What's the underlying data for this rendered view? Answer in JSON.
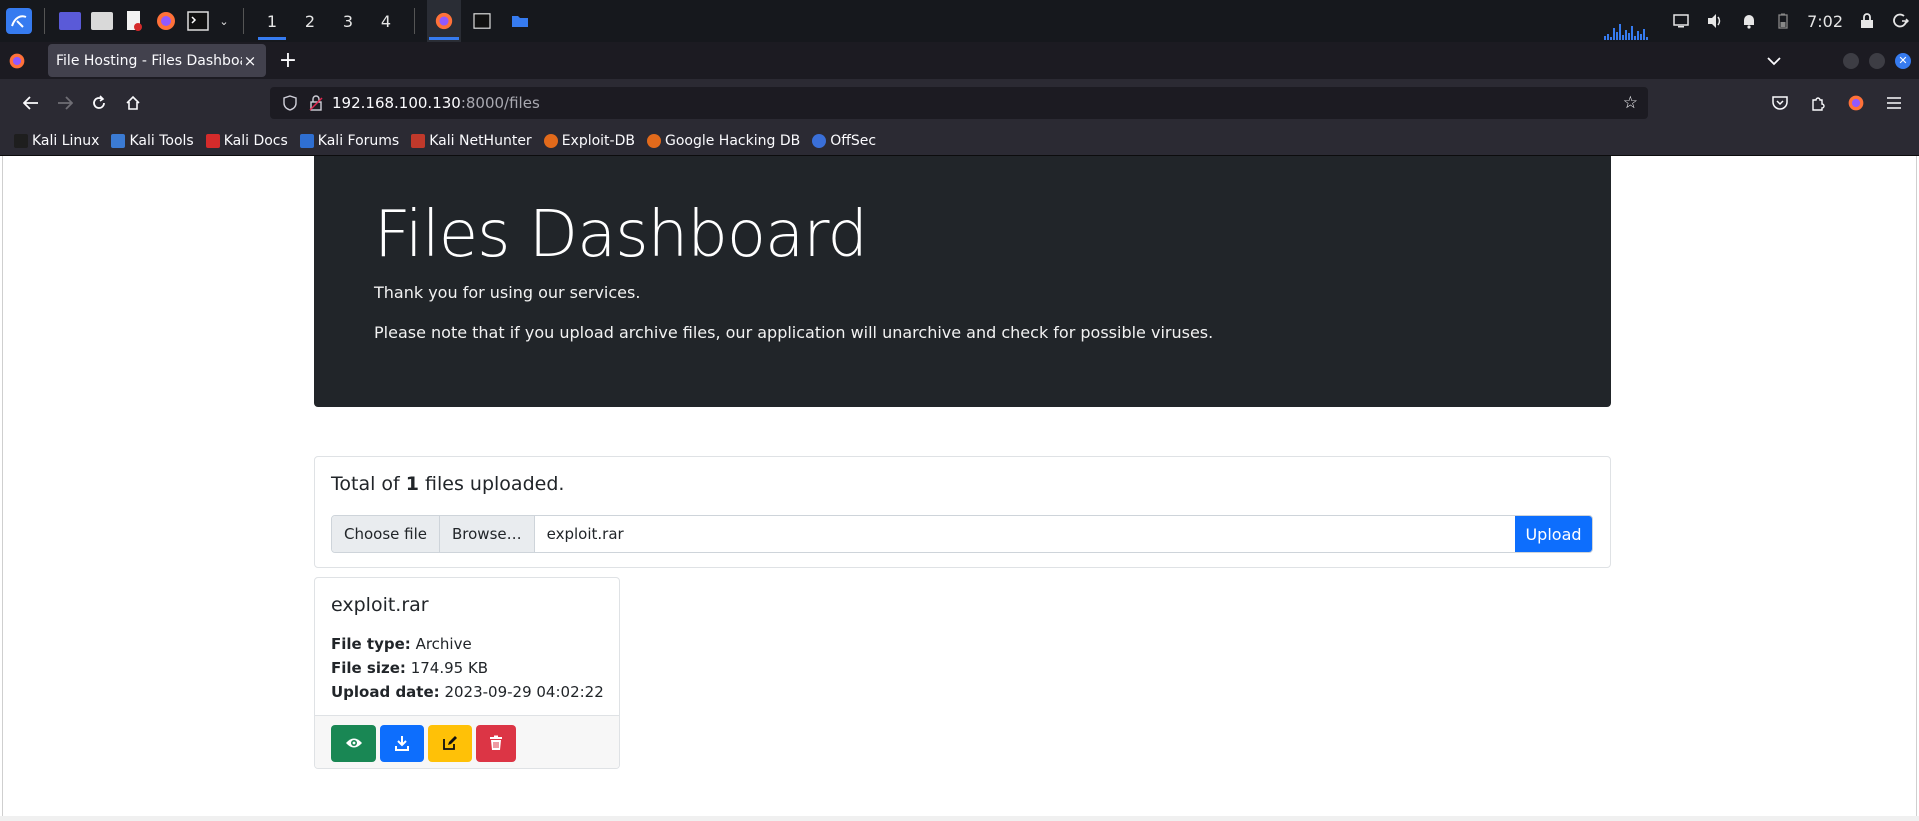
{
  "panel": {
    "workspaces": [
      "1",
      "2",
      "3",
      "4"
    ],
    "active_workspace": "1",
    "clock": "7:02"
  },
  "browser": {
    "tab_title": "File Hosting - Files Dashboard",
    "tab_close": "×",
    "new_tab": "+",
    "url_host": "192.168.100.130",
    "url_rest": ":8000/files"
  },
  "bookmarks": [
    {
      "label": "Kali Linux",
      "color": "#1e1e1e"
    },
    {
      "label": "Kali Tools",
      "color": "#3b7bd4"
    },
    {
      "label": "Kali Docs",
      "color": "#d52b2b"
    },
    {
      "label": "Kali Forums",
      "color": "#2f6fd1"
    },
    {
      "label": "Kali NetHunter",
      "color": "#c0392b"
    },
    {
      "label": "Exploit-DB",
      "color": "#e26a1b"
    },
    {
      "label": "Google Hacking DB",
      "color": "#e26a1b"
    },
    {
      "label": "OffSec",
      "color": "#3a6fd8"
    }
  ],
  "page": {
    "title": "Files Dashboard",
    "thanks": "Thank you for using our services.",
    "note": "Please note that if you upload archive files, our application will unarchive and check for possible viruses.",
    "total_prefix": "Total of ",
    "total_count": "1",
    "total_suffix": " files uploaded.",
    "choose_file": "Choose file",
    "browse": "Browse…",
    "selected_file": "exploit.rar",
    "upload_label": "Upload"
  },
  "files": [
    {
      "name": "exploit.rar",
      "type_label": "File type:",
      "type": "Archive",
      "size_label": "File size:",
      "size": "174.95 KB",
      "date_label": "Upload date:",
      "date": "2023-09-29 04:02:22"
    }
  ],
  "colors": {
    "hero_bg": "#212529",
    "primary": "#0d6efd",
    "success": "#198754",
    "warning": "#ffc107",
    "danger": "#dc3545"
  },
  "icons": {
    "view": "eye-icon",
    "download": "download-icon",
    "edit": "edit-icon",
    "delete": "trash-icon"
  }
}
